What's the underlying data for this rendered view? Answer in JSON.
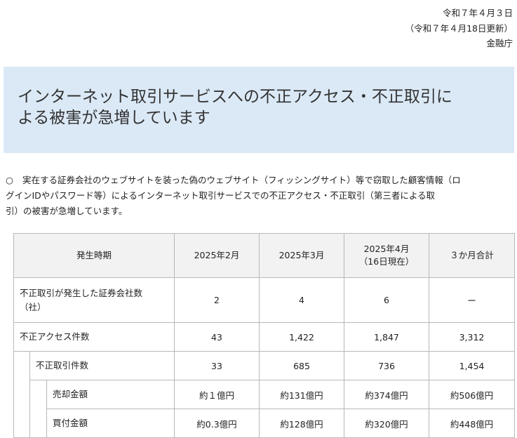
{
  "meta": {
    "date": "令和７年４月３日",
    "updated": "（令和７年４月18日更新）",
    "agency": "金融庁"
  },
  "banner": {
    "title_line1": "インターネット取引サービスへの不正アクセス・不正取引に",
    "title_line2": "よる被害が急増しています"
  },
  "lead": {
    "mark": "○",
    "line1": "実在する証券会社のウェブサイトを装った偽のウェブサイト（フィッシングサイト）等で窃取した顧客情報（ロ",
    "line2": "グインIDやパスワード等）によるインターネット取引サービスでの不正アクセス・不正取引（第三者による取",
    "line3": "引）の被害が急増しています。"
  },
  "table": {
    "headers": [
      "発生時期",
      "2025年2月",
      "2025年3月",
      "2025年4月",
      "（16日現在）",
      "３か月合計"
    ],
    "rows": [
      {
        "label_line1": "不正取引が発生した証券会社数",
        "label_line2": "（社）",
        "values": [
          "2",
          "4",
          "6",
          "ー"
        ]
      },
      {
        "label": "不正アクセス件数",
        "values": [
          "43",
          "1,422",
          "1,847",
          "3,312"
        ]
      },
      {
        "label": "不正取引件数",
        "values": [
          "33",
          "685",
          "736",
          "1,454"
        ]
      },
      {
        "label": "売却金額",
        "values": [
          "約１億円",
          "約131億円",
          "約374億円",
          "約506億円"
        ]
      },
      {
        "label": "買付金額",
        "values": [
          "約0.3億円",
          "約128億円",
          "約320億円",
          "約448億円"
        ]
      }
    ]
  }
}
